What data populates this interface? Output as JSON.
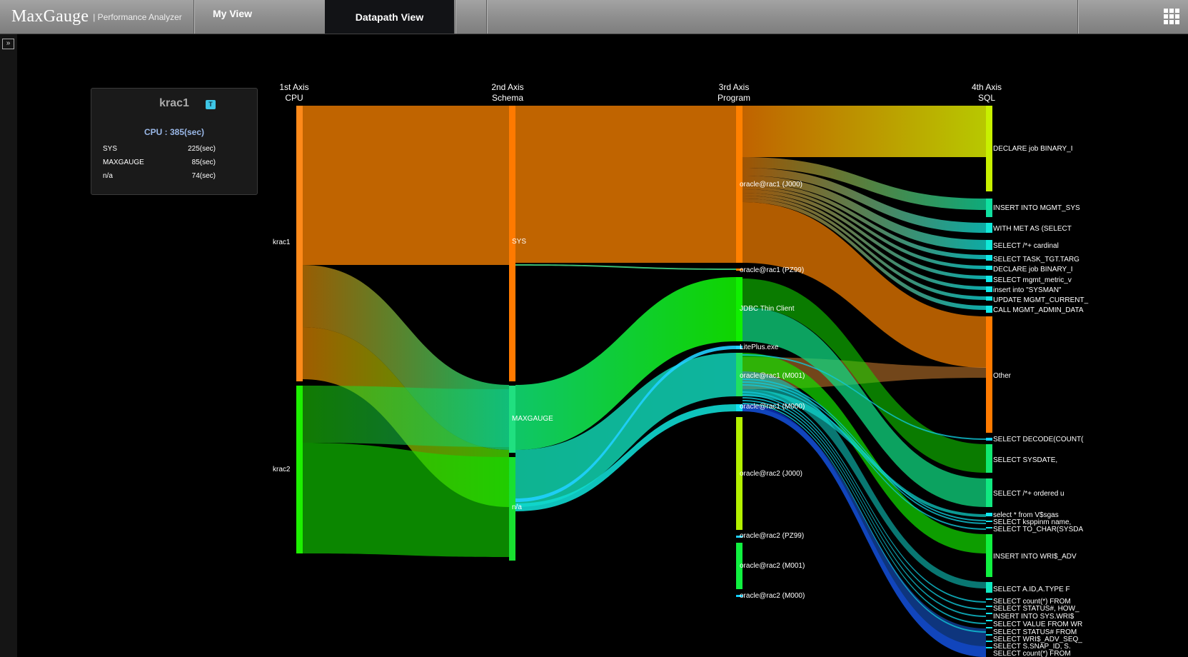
{
  "header": {
    "logo": "MaxGauge",
    "logo_sub": "| Performance Analyzer",
    "tabs": [
      {
        "label": "My View",
        "active": false
      },
      {
        "label": "Datapath View",
        "active": true
      }
    ],
    "apps_icon": "grid-icon",
    "expand_icon": "double-chevron-right-icon"
  },
  "info_panel": {
    "title": "krac1",
    "badge": "T",
    "cpu": "CPU : 385(sec)",
    "rows": [
      {
        "name": "SYS",
        "value": "225(sec)"
      },
      {
        "name": "MAXGAUGE",
        "value": "85(sec)"
      },
      {
        "name": "n/a",
        "value": "74(sec)"
      }
    ]
  },
  "sankey": {
    "axes": [
      {
        "line1": "1st Axis",
        "line2": "CPU"
      },
      {
        "line1": "2nd Axis",
        "line2": "Schema"
      },
      {
        "line1": "3rd Axis",
        "line2": "Program"
      },
      {
        "line1": "4th Axis",
        "line2": "SQL"
      }
    ],
    "colors": {
      "orange": "#c06400",
      "green": "#12e000",
      "cyan": "#10d8d0",
      "lime": "#a6c400",
      "blue": "#0a2cb0"
    },
    "axis1": [
      {
        "label": "krac1",
        "color": "#ff8a1a"
      },
      {
        "label": "krac2",
        "color": "#1df000"
      }
    ],
    "axis2": [
      {
        "label": "SYS",
        "color": "#ff7a00"
      },
      {
        "label": "MAXGAUGE",
        "color": "#20e080"
      },
      {
        "label": "n/a",
        "color": "#18e030"
      }
    ],
    "axis3": [
      {
        "label": "oracle@rac1 (J000)",
        "color": "#ff8000"
      },
      {
        "label": "oracle@rac1 (PZ99)",
        "color": "#ff8000"
      },
      {
        "label": "JDBC Thin Client",
        "color": "#10f000"
      },
      {
        "label": "LitePlus.exe",
        "color": "#20d0ff"
      },
      {
        "label": "oracle@rac1 (M001)",
        "color": "#20e060"
      },
      {
        "label": "oracle@rac1 (M000)",
        "color": "#10e0f0"
      },
      {
        "label": "oracle@rac2 (J000)",
        "color": "#b4f000"
      },
      {
        "label": "oracle@rac2 (PZ99)",
        "color": "#20d0ff"
      },
      {
        "label": "oracle@rac2 (M001)",
        "color": "#10f040"
      },
      {
        "label": "oracle@rac2 (M000)",
        "color": "#10d0ff"
      }
    ],
    "axis4": [
      {
        "label": "DECLARE job BINARY_I",
        "color": "#c8f000"
      },
      {
        "label": "INSERT INTO MGMT_SYS",
        "color": "#10e0a0"
      },
      {
        "label": "WITH MET AS (SELECT",
        "color": "#10e8d8"
      },
      {
        "label": "SELECT /*+  cardinal",
        "color": "#10e8d8"
      },
      {
        "label": "SELECT TASK_TGT.TARG",
        "color": "#10e8e8"
      },
      {
        "label": "DECLARE job BINARY_I",
        "color": "#10e8e8"
      },
      {
        "label": "SELECT mgmt_metric_v",
        "color": "#10e8e8"
      },
      {
        "label": "insert into \"SYSMAN\"",
        "color": "#10e8e8"
      },
      {
        "label": "UPDATE MGMT_CURRENT_",
        "color": "#10e8e8"
      },
      {
        "label": "CALL MGMT_ADMIN_DATA",
        "color": "#10e8e8"
      },
      {
        "label": "Other",
        "color": "#ff7a00"
      },
      {
        "label": "SELECT DECODE(COUNT(",
        "color": "#10d0ff"
      },
      {
        "label": "SELECT SYSDATE,",
        "color": "#10e870"
      },
      {
        "label": "SELECT /*+ ordered u",
        "color": "#10e880"
      },
      {
        "label": "select * from V$sgas",
        "color": "#10e8f0"
      },
      {
        "label": "SELECT ksppinm name,",
        "color": "#10e8f0"
      },
      {
        "label": "SELECT TO_CHAR(SYSDA",
        "color": "#10e8f0"
      },
      {
        "label": "INSERT INTO WRI$_ADV",
        "color": "#10f040"
      },
      {
        "label": "SELECT A.ID,A.TYPE F",
        "color": "#10e8c0"
      },
      {
        "label": "SELECT count(*) FROM",
        "color": "#10e8f0"
      },
      {
        "label": "SELECT STATUS#, HOW_",
        "color": "#10e8f0"
      },
      {
        "label": "INSERT INTO SYS.WRI$",
        "color": "#10e8f0"
      },
      {
        "label": "SELECT VALUE FROM WR",
        "color": "#10e8f0"
      },
      {
        "label": "SELECT STATUS# FROM",
        "color": "#10e8f0"
      },
      {
        "label": "SELECT WRI$_ADV_SEQ_",
        "color": "#10e8f0"
      },
      {
        "label": "SELECT S.SNAP_ID, S.",
        "color": "#10e8f0"
      },
      {
        "label": "SELECT count(*) FROM",
        "color": "#10e8f0"
      }
    ]
  }
}
